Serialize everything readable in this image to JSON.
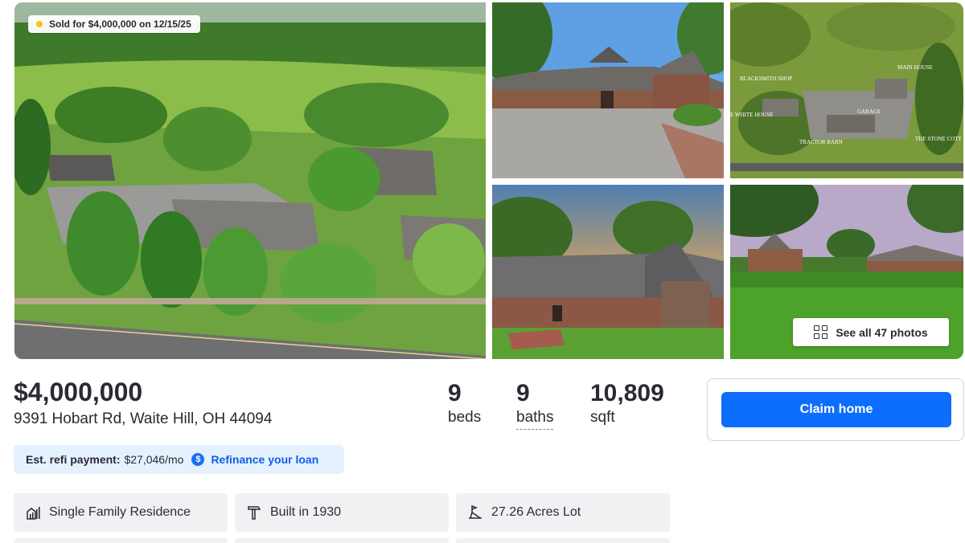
{
  "gallery": {
    "sold_badge": "Sold for $4,000,000 on 12/15/25",
    "see_all_label": "See all 47 photos",
    "aerial_labels": [
      "BLACKSMITH SHOP",
      "MAIN HOUSE",
      "GARAGE",
      "E WHITE HOUSE",
      "TRACTOR BARN",
      "THE STONE COTT"
    ]
  },
  "summary": {
    "price": "$4,000,000",
    "address": "9391 Hobart Rd, Waite Hill, OH 44094",
    "beds_value": "9",
    "beds_label": "beds",
    "baths_value": "9",
    "baths_label": "baths",
    "sqft_value": "10,809",
    "sqft_label": "sqft"
  },
  "refi": {
    "label": "Est. refi payment:",
    "amount": "$27,046/mo",
    "link": "Refinance your loan"
  },
  "claim": {
    "button_label": "Claim home"
  },
  "facts": [
    {
      "label": "Single Family Residence",
      "icon": "building-chart-icon"
    },
    {
      "label": "Built in 1930",
      "icon": "hammer-icon"
    },
    {
      "label": "27.26 Acres Lot",
      "icon": "lot-size-icon"
    }
  ],
  "colors": {
    "accent_blue": "#0d6efd",
    "link_blue": "#0d5fe6",
    "refi_bg": "#e6f1ff",
    "fact_bg": "#f1f1f4",
    "text": "#2a2a33"
  }
}
